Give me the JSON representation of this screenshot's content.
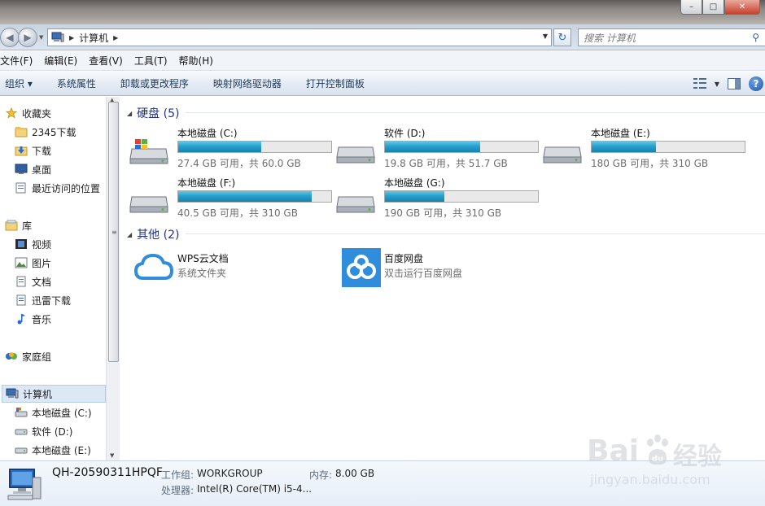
{
  "window": {
    "min_glyph": "–",
    "max_glyph": "□",
    "close_glyph": "✕"
  },
  "nav": {
    "address_segment": "计算机",
    "search_placeholder": "搜索 计算机"
  },
  "menu": [
    "文件(F)",
    "编辑(E)",
    "查看(V)",
    "工具(T)",
    "帮助(H)"
  ],
  "commands": [
    "组织 ▾",
    "系统属性",
    "卸载或更改程序",
    "映射网络驱动器",
    "打开控制面板"
  ],
  "sidebar": {
    "favorites": "收藏夹",
    "fav_items": [
      "2345下载",
      "下载",
      "桌面",
      "最近访问的位置"
    ],
    "libraries": "库",
    "lib_items": [
      "视频",
      "图片",
      "文档",
      "迅雷下载",
      "音乐"
    ],
    "homegroup": "家庭组",
    "computer": "计算机",
    "computer_items": [
      "本地磁盘 (C:)",
      "软件 (D:)",
      "本地磁盘 (E:)"
    ]
  },
  "groups": {
    "hdd_title": "硬盘 (5)",
    "other_title": "其他 (2)"
  },
  "drives": [
    {
      "name": "本地磁盘 (C:)",
      "space": "27.4 GB 可用，共 60.0 GB",
      "used_fraction": 0.54
    },
    {
      "name": "软件 (D:)",
      "space": "19.8 GB 可用，共 51.7 GB",
      "used_fraction": 0.62
    },
    {
      "name": "本地磁盘 (E:)",
      "space": "180 GB 可用，共 310 GB",
      "used_fraction": 0.42
    },
    {
      "name": "本地磁盘 (F:)",
      "space": "40.5 GB 可用，共 310 GB",
      "used_fraction": 0.87
    },
    {
      "name": "本地磁盘 (G:)",
      "space": "190 GB 可用，共 310 GB",
      "used_fraction": 0.39
    }
  ],
  "others": [
    {
      "name": "WPS云文档",
      "sub": "系统文件夹"
    },
    {
      "name": "百度网盘",
      "sub": "双击运行百度网盘"
    }
  ],
  "details": {
    "pc_name": "QH-20590311HPQF",
    "workgroup_label": "工作组:",
    "workgroup_value": "WORKGROUP",
    "memory_label": "内存:",
    "memory_value": "8.00 GB",
    "cpu_label": "处理器:",
    "cpu_value": "Intel(R) Core(TM) i5-4..."
  },
  "watermark": {
    "brand": "Bai",
    "brand_cn": "经验",
    "url": "jingyan.baidu.com"
  },
  "colors": {
    "bar_fill": "#27a0cc",
    "group_title": "#1e3287",
    "selection": "#dce8f6"
  }
}
